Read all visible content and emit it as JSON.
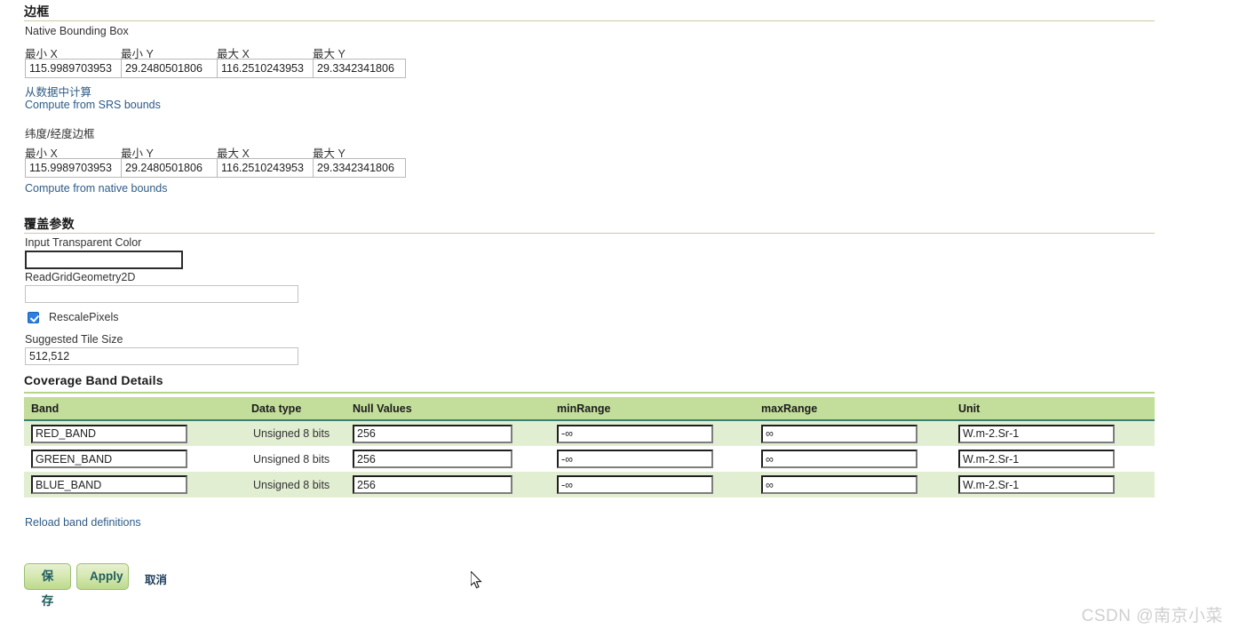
{
  "bounding_box_section": {
    "heading": "边框",
    "native": {
      "label": "Native Bounding Box",
      "field_labels": [
        "最小 X",
        "最小 Y",
        "最大 X",
        "最大 Y"
      ],
      "values": [
        "115.9989703953",
        "29.2480501806",
        "116.2510243953",
        "29.3342341806"
      ],
      "links": [
        "从数据中计算",
        "Compute from SRS bounds"
      ]
    },
    "latlon": {
      "label": "纬度/经度边框",
      "field_labels": [
        "最小 X",
        "最小 Y",
        "最大 X",
        "最大 Y"
      ],
      "values": [
        "115.9989703953",
        "29.2480501806",
        "116.2510243953",
        "29.3342341806"
      ],
      "links": [
        "Compute from native bounds"
      ]
    }
  },
  "coverage_params_section": {
    "heading": "覆盖参数",
    "input_transparent_color": {
      "label": "Input Transparent Color",
      "value": "",
      "placeholder": ""
    },
    "read_grid_geometry_2d": {
      "label": "ReadGridGeometry2D",
      "value": "",
      "placeholder": ""
    },
    "rescale_pixels": {
      "label": "RescalePixels",
      "checked": true
    },
    "suggested_tile_size": {
      "label": "Suggested Tile Size",
      "value": "512,512",
      "placeholder": ""
    }
  },
  "band_details_section": {
    "heading": "Coverage Band Details",
    "columns": [
      "Band",
      "Data type",
      "Null Values",
      "minRange",
      "maxRange",
      "Unit"
    ],
    "rows": [
      {
        "band": "RED_BAND",
        "data_type": "Unsigned 8 bits",
        "null_values": "256",
        "min_range": "-∞",
        "max_range": "∞",
        "unit": "W.m-2.Sr-1"
      },
      {
        "band": "GREEN_BAND",
        "data_type": "Unsigned 8 bits",
        "null_values": "256",
        "min_range": "-∞",
        "max_range": "∞",
        "unit": "W.m-2.Sr-1"
      },
      {
        "band": "BLUE_BAND",
        "data_type": "Unsigned 8 bits",
        "null_values": "256",
        "min_range": "-∞",
        "max_range": "∞",
        "unit": "W.m-2.Sr-1"
      }
    ],
    "reload_link": "Reload band definitions"
  },
  "footer": {
    "save_label": "保存",
    "apply_label": "Apply",
    "cancel_label": "取消"
  },
  "watermark": "CSDN @南京小菜",
  "colors": {
    "table_header_bg": "#c3dd9b",
    "table_row_alt_bg": "#e2eed2",
    "header_border": "#3d7e72",
    "link": "#2e5b86",
    "button_text": "#215d5f",
    "rule": "#c9c9a8",
    "rule_green": "#b7d48b",
    "checkbox": "#2f7fe0"
  }
}
